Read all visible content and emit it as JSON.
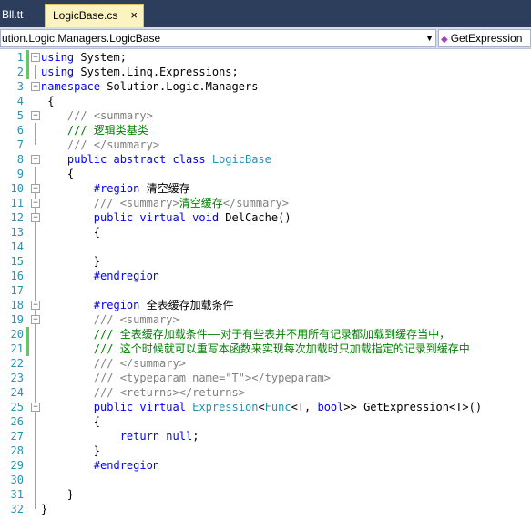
{
  "tabs": {
    "inactive_label": "Bll.tt",
    "active_label": "LogicBase.cs",
    "close_glyph": "×"
  },
  "nav": {
    "class_combo": "ution.Logic.Managers.LogicBase",
    "member_combo": "GetExpression"
  },
  "code": {
    "l1": {
      "n": "1",
      "a": "using",
      "b": " System;"
    },
    "l2": {
      "n": "2",
      "a": "using",
      "b": " System.Linq.Expressions;"
    },
    "l3": {
      "n": "3",
      "a": "namespace",
      "b": " Solution.Logic.Managers"
    },
    "l4": {
      "n": "4",
      "t": "{"
    },
    "l5": {
      "n": "5",
      "a": "///",
      "b": " <summary>"
    },
    "l6": {
      "n": "6",
      "a": "/// 逻辑类基类"
    },
    "l7": {
      "n": "7",
      "a": "///",
      "b": " </summary>"
    },
    "l8": {
      "n": "8",
      "a": "public abstract class",
      "b": " LogicBase"
    },
    "l9": {
      "n": "9",
      "t": "{"
    },
    "l10": {
      "n": "10",
      "a": "#region",
      "b": " 清空缓存"
    },
    "l11": {
      "n": "11",
      "a": "///",
      "b": " <summary>",
      "c": "清空缓存",
      "d": "</summary>"
    },
    "l12": {
      "n": "12",
      "a": "public virtual void",
      "b": " DelCache()"
    },
    "l13": {
      "n": "13",
      "t": "{"
    },
    "l14": {
      "n": "14"
    },
    "l15": {
      "n": "15",
      "t": "}"
    },
    "l16": {
      "n": "16",
      "a": "#endregion"
    },
    "l17": {
      "n": "17"
    },
    "l18": {
      "n": "18",
      "a": "#region",
      "b": " 全表缓存加载条件"
    },
    "l19": {
      "n": "19",
      "a": "///",
      "b": " <summary>"
    },
    "l20": {
      "n": "20",
      "a": "/// 全表缓存加载条件——对于有些表并不用所有记录都加载到缓存当中，"
    },
    "l21": {
      "n": "21",
      "a": "/// 这个时候就可以重写本函数来实现每次加载时只加载指定的记录到缓存中"
    },
    "l22": {
      "n": "22",
      "a": "///",
      "b": " </summary>"
    },
    "l23": {
      "n": "23",
      "a": "///",
      "b": " <typeparam name=\"T\"></typeparam>"
    },
    "l24": {
      "n": "24",
      "a": "///",
      "b": " <returns></returns>"
    },
    "l25": {
      "n": "25",
      "a": "public virtual",
      "b": " Expression",
      "c": "<",
      "d": "Func",
      "e": "<T, ",
      "f": "bool",
      "g": ">> GetExpression<T>()"
    },
    "l26": {
      "n": "26",
      "t": "{"
    },
    "l27": {
      "n": "27",
      "a": "return null",
      "b": ";"
    },
    "l28": {
      "n": "28",
      "t": "}"
    },
    "l29": {
      "n": "29",
      "a": "#endregion"
    },
    "l30": {
      "n": "30"
    },
    "l31": {
      "n": "31",
      "t": "}"
    },
    "l32": {
      "n": "32",
      "t": "}"
    }
  },
  "colors": {
    "keyword": "#0000ff",
    "comment": "#008000",
    "doc_tag": "#808080",
    "type": "#2b91af",
    "change_marker": "#6cc16c"
  }
}
